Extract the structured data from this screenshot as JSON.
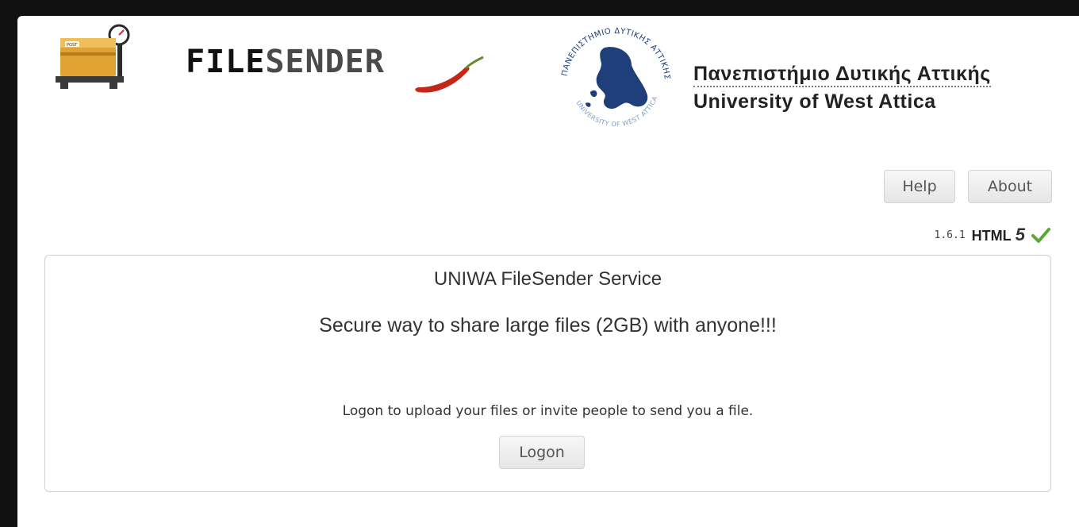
{
  "brand": {
    "name_part1": "FILE",
    "name_part2": "SENDER"
  },
  "university": {
    "name_greek": "Πανεπιστήμιο Δυτικής Αττικής",
    "name_english": "University of West Attica",
    "seal_text_top": "ΠΑΝΕΠΙΣΤΗΜΙΟ ΔΥΤΙΚΗΣ ΑΤΤΙΚΗΣ",
    "seal_text_bottom": "UNIVERSITY OF WEST ATTICA"
  },
  "nav": {
    "help_label": "Help",
    "about_label": "About"
  },
  "footer_info": {
    "version": "1.6.1",
    "html_label": "HTML",
    "html_version": "5"
  },
  "main": {
    "title": "UNIWA FileSender Service",
    "tagline": "Secure way to share large files (2GB) with anyone!!!",
    "logon_message": "Logon to upload your files or invite people to send you a file.",
    "logon_button": "Logon"
  },
  "icons": {
    "brand_logo": "scale-with-package-icon",
    "chili": "chili-pepper-icon",
    "seal": "university-seal-icon",
    "check": "checkmark-icon"
  },
  "colors": {
    "check_green": "#5aa832",
    "seal_blue": "#1e3f7a",
    "chili_red": "#c4261a"
  }
}
